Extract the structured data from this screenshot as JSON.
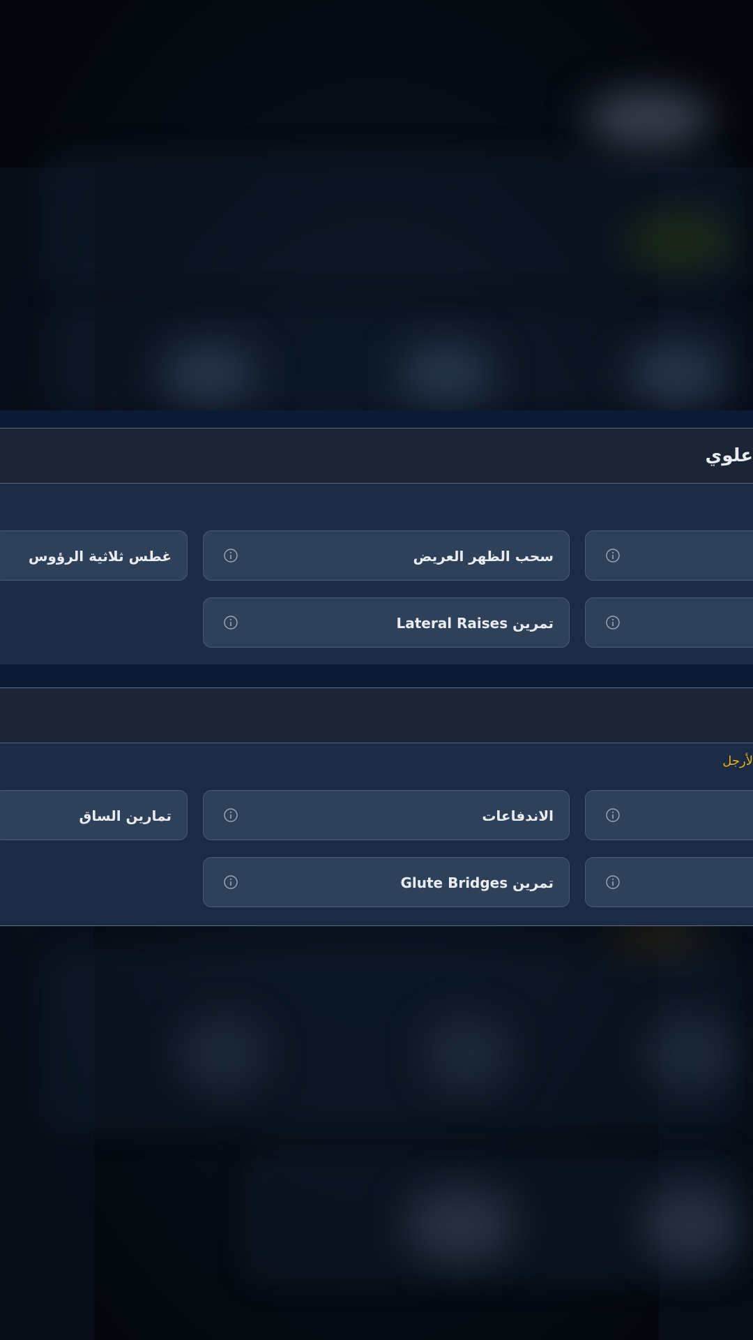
{
  "colors": {
    "accent": "#e5b21f",
    "card_bg": "#2f4159",
    "section_bg": "#1b2b43",
    "header_bg": "#1b2535"
  },
  "upper_section": {
    "title": "علوي",
    "cards": [
      {
        "label": "غطس ثلاثية الرؤوس",
        "icon": "info-icon"
      },
      {
        "label": "سحب الظهر العريض",
        "icon": "info-icon"
      },
      {
        "label": "",
        "icon": "info-icon"
      },
      {
        "label": "تمرين Lateral Raises",
        "icon": "info-icon"
      },
      {
        "label": "",
        "icon": "info-icon"
      }
    ]
  },
  "lower_section": {
    "subtitle": "لأرجل",
    "cards": [
      {
        "label": "تمارين الساق",
        "icon": "info-icon"
      },
      {
        "label": "الاندفاعات",
        "icon": "info-icon"
      },
      {
        "label": "",
        "icon": "info-icon"
      },
      {
        "label": "تمرين Glute Bridges",
        "icon": "info-icon"
      },
      {
        "label": "",
        "icon": "info-icon"
      }
    ]
  }
}
